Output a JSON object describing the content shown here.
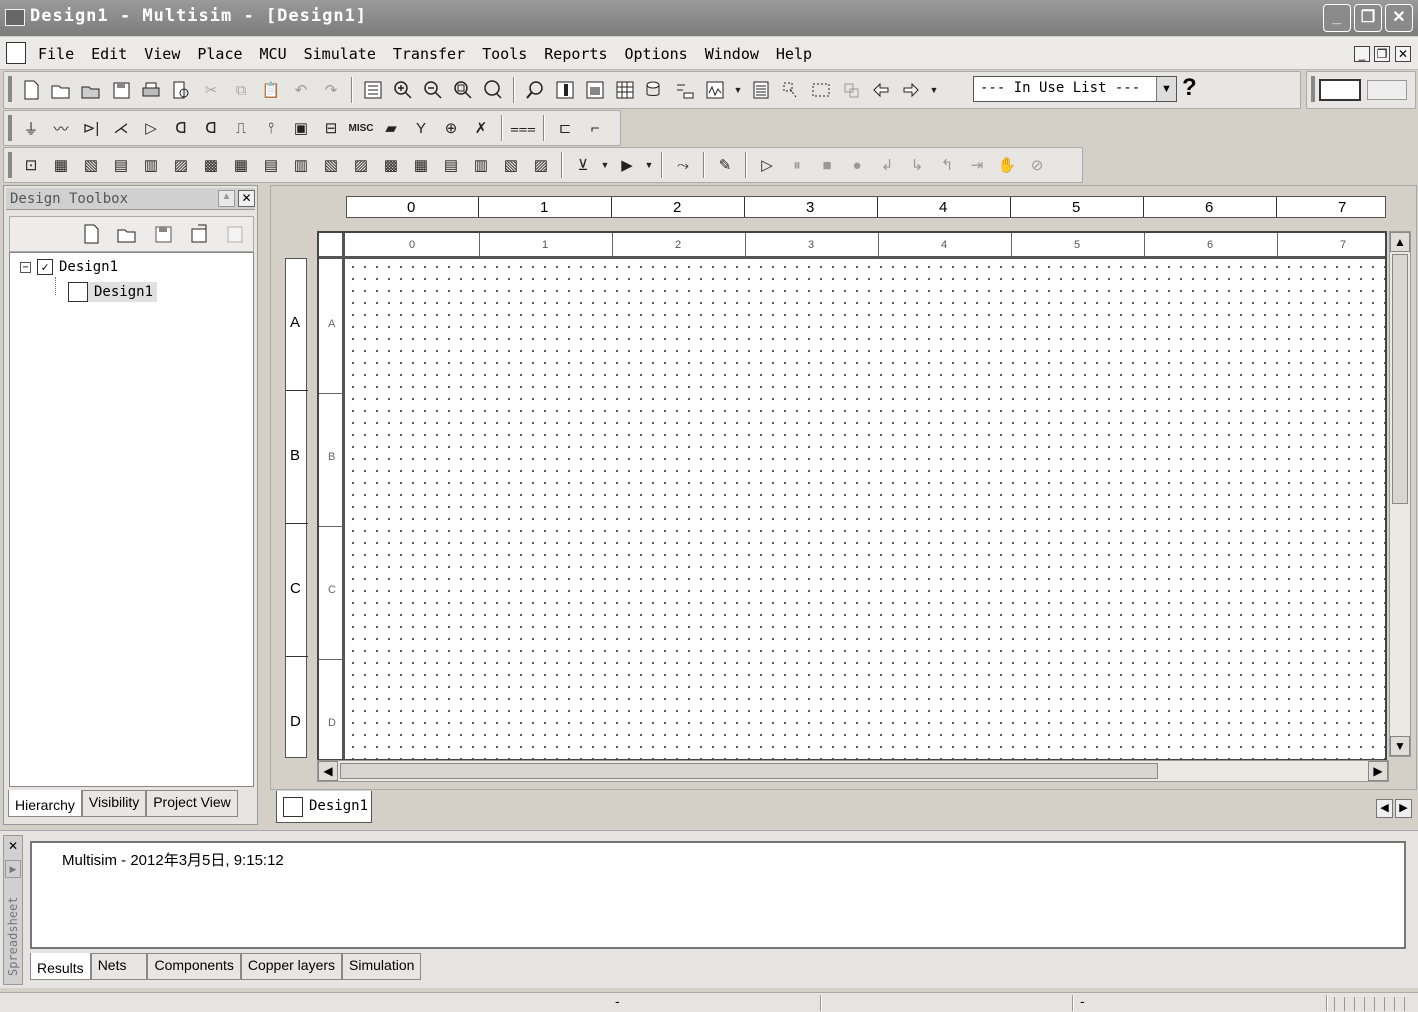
{
  "window": {
    "title": "Design1 - Multisim - [Design1]",
    "minimize": "_",
    "restore": "❐",
    "close": "✕"
  },
  "menu": {
    "items": [
      "File",
      "Edit",
      "View",
      "Place",
      "MCU",
      "Simulate",
      "Transfer",
      "Tools",
      "Reports",
      "Options",
      "Window",
      "Help"
    ],
    "doc_min": "_",
    "doc_restore": "❐",
    "doc_close": "✕"
  },
  "toolbar": {
    "in_use_list": "--- In Use List ---",
    "help": "?",
    "misc_label": "MISC"
  },
  "design_toolbox": {
    "title": "Design Toolbox",
    "tree": {
      "root": "Design1",
      "child": "Design1"
    },
    "tabs": [
      "Hierarchy",
      "Visibility",
      "Project View"
    ]
  },
  "workspace": {
    "title_block_columns": [
      "0",
      "1",
      "2",
      "3",
      "4",
      "5",
      "6",
      "7"
    ],
    "row_labels": [
      "A",
      "B",
      "C",
      "D"
    ],
    "document_tab": "Design1"
  },
  "spreadsheet": {
    "side_label": "Spreadsheet",
    "message": "Multisim  -  2012年3月5日, 9:15:12",
    "tabs": [
      "Results",
      "Nets",
      "Components",
      "Copper layers",
      "Simulation"
    ]
  },
  "status": {
    "field1": "-",
    "field2": "-"
  }
}
